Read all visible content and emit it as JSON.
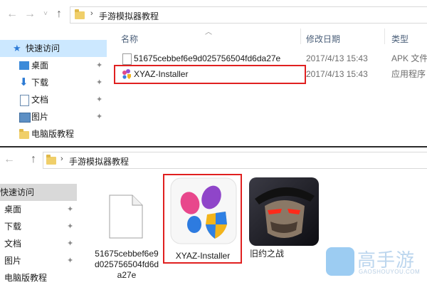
{
  "top_window": {
    "address": {
      "path_segment": "手游模拟器教程"
    },
    "nav_pane": {
      "items": [
        {
          "label": "快速访问",
          "icon": "star-icon",
          "selected": true
        },
        {
          "label": "桌面",
          "icon": "desktop-icon",
          "pinned": true
        },
        {
          "label": "下载",
          "icon": "download-icon",
          "pinned": true
        },
        {
          "label": "文档",
          "icon": "documents-icon",
          "pinned": true
        },
        {
          "label": "图片",
          "icon": "pictures-icon",
          "pinned": true
        },
        {
          "label": "电脑版教程",
          "icon": "folder-icon",
          "pinned": false
        }
      ]
    },
    "columns": {
      "name": "名称",
      "date": "修改日期",
      "type": "类型"
    },
    "files": [
      {
        "name": "51675cebbef6e9d025756504fd6da27e",
        "date": "2017/4/13 15:43",
        "type": "APK 文件",
        "icon": "file-icon"
      },
      {
        "name": "XYAZ-Installer",
        "date": "2017/4/13 15:43",
        "type": "应用程序",
        "icon": "xyaz-app-icon",
        "highlighted": true
      }
    ]
  },
  "bottom_window": {
    "address": {
      "path_segment": "手游模拟器教程"
    },
    "nav_pane": {
      "items": [
        {
          "label": "快速访问",
          "selected": true
        },
        {
          "label": "桌面",
          "pinned": true
        },
        {
          "label": "下载",
          "pinned": true
        },
        {
          "label": "文档",
          "pinned": true
        },
        {
          "label": "图片",
          "pinned": true
        },
        {
          "label": "电脑版教程",
          "pinned": false
        }
      ]
    },
    "tiles": [
      {
        "label": "51675cebbef6e9d025756504fd6da27e",
        "icon": "blank-file-icon"
      },
      {
        "label": "XYAZ-Installer",
        "icon": "xyaz-app-icon",
        "highlighted": true
      },
      {
        "label": "旧约之战",
        "icon": "game-thumbnail-icon"
      }
    ]
  },
  "watermark": {
    "brand": "高手游",
    "domain": "GAOSHOUYOU.COM"
  },
  "colors": {
    "highlight_red": "#e02020",
    "nav_selected": "#cce8ff",
    "folder": "#f0cf6a"
  }
}
